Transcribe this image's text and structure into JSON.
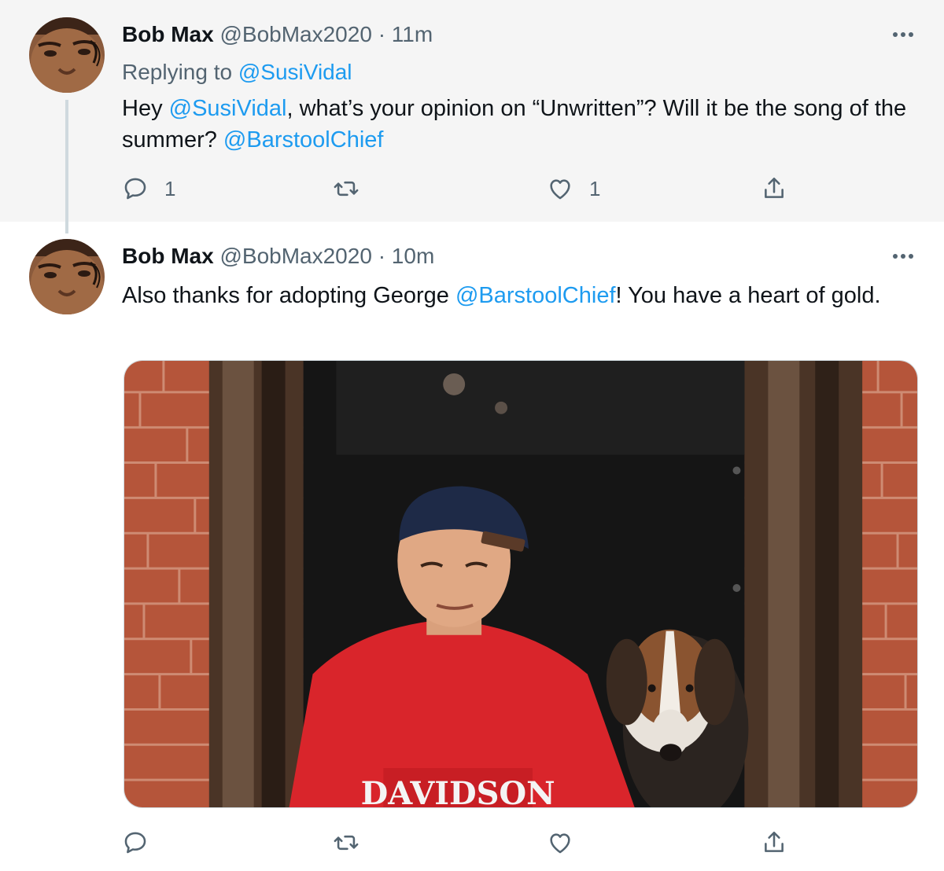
{
  "tweets": [
    {
      "author_name": "Bob Max",
      "handle": "@BobMax2020",
      "separator": "·",
      "time": "11m",
      "replying_to_label": "Replying to",
      "replying_to_handle": "@SusiVidal",
      "text_parts": [
        "Hey ",
        "@SusiVidal",
        ", what’s your opinion on “Unwritten”? Will it be the song of the summer? ",
        "@BarstoolChief"
      ],
      "reply_count": "1",
      "retweet_count": "",
      "like_count": "1"
    },
    {
      "author_name": "Bob Max",
      "handle": "@BobMax2020",
      "separator": "·",
      "time": "10m",
      "text_parts": [
        "Also thanks for adopting George ",
        "@BarstoolChief",
        "! You have a heart of gold."
      ],
      "media_shirt_text": "DAVIDSON",
      "reply_count": "",
      "retweet_count": "",
      "like_count": ""
    }
  ],
  "colors": {
    "link": "#1d9bf0",
    "muted": "#536471",
    "text": "#0f1419",
    "highlight_bg": "#f5f5f5"
  },
  "icons": {
    "avatar": "avatar-icon",
    "more": "more-icon",
    "reply": "reply-icon",
    "retweet": "retweet-icon",
    "like": "heart-icon",
    "share": "share-icon"
  }
}
